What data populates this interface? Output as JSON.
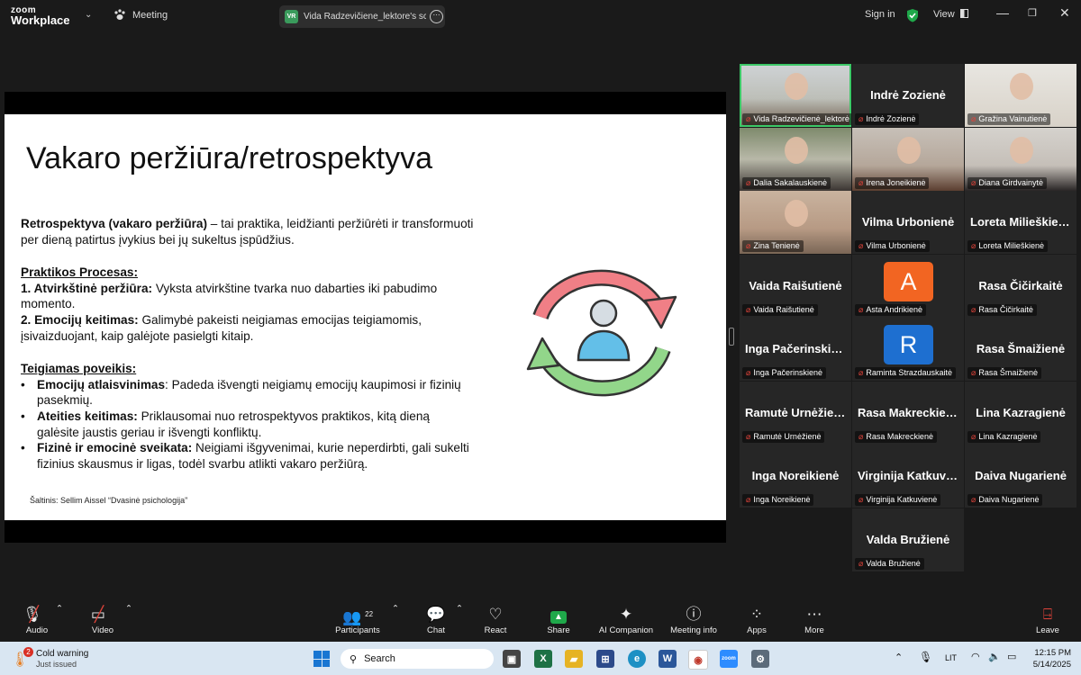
{
  "app": {
    "logo_line1": "zoom",
    "logo_line2": "Workplace",
    "meeting_label": "Meeting",
    "share_badge": "VR",
    "share_title": "Vida Radzevičiene_lektore's screen",
    "sign_in": "Sign in",
    "view_label": "View",
    "accent_green": "#3cc867"
  },
  "slide": {
    "title": "Vakaro peržiūra/retrospektyva",
    "intro_bold": "Retrospektyva (vakaro peržiūra)",
    "intro_rest": " – tai praktika, leidžianti peržiūrėti ir transformuoti per dieną patirtus įvykius bei jų sukeltus įspūdžius.",
    "process_heading": "Praktikos Procesas:",
    "step1_bold": "1. Atvirkštinė peržiūra:",
    "step1_rest": " Vyksta atvirkštine tvarka nuo dabarties iki pabudimo momento.",
    "step2_bold": "2. Emocijų keitimas:",
    "step2_rest": " Galimybė pakeisti neigiamas emocijas teigiamomis, įsivaizduojant, kaip galėjote pasielgti kitaip.",
    "effect_heading": "Teigiamas poveikis:",
    "bullet_char": "•",
    "bullets": [
      {
        "bold": "Emocijų atlaisvinimas",
        "rest": ": Padeda išvengti neigiamų emocijų kaupimosi ir fizinių pasekmių."
      },
      {
        "bold": "Ateities keitimas:",
        "rest": " Priklausomai nuo retrospektyvos praktikos, kitą dieną galėsite jaustis geriau ir išvengti konfliktų."
      },
      {
        "bold": "Fizinė ir emocinė sveikata:",
        "rest": " Neigiami išgyvenimai, kurie neperdirbti, gali sukelti fizinius skausmus ir ligas, todėl svarbu atlikti vakaro peržiūrą."
      }
    ],
    "source": "Šaltinis: Sellim Aissel “Dvasinė psichologija”"
  },
  "participants": [
    {
      "label": "Vida Radzevičienė_lektorė",
      "big": "",
      "type": "video"
    },
    {
      "label": "Indrė Zozienė",
      "big": "Indrė Zozienė",
      "type": "name"
    },
    {
      "label": "Gražina Vainutienė",
      "big": "",
      "type": "video"
    },
    {
      "label": "Dalia Sakalauskienė",
      "big": "",
      "type": "video"
    },
    {
      "label": "Irena Joneikienė",
      "big": "",
      "type": "video"
    },
    {
      "label": "Diana Girdvainytė",
      "big": "",
      "type": "video"
    },
    {
      "label": "Zina Tenienė",
      "big": "",
      "type": "video"
    },
    {
      "label": "Vilma Urbonienė",
      "big": "Vilma Urbonienė",
      "type": "name"
    },
    {
      "label": "Loreta Milieškienė",
      "big": "Loreta Milieškienė",
      "type": "name"
    },
    {
      "label": "Vaida Raišutienė",
      "big": "Vaida Raišutienė",
      "type": "name"
    },
    {
      "label": "Asta Andrikienė",
      "big": "A",
      "type": "avatar",
      "color": "#f26522"
    },
    {
      "label": "Rasa Čičirkaitė",
      "big": "Rasa Čičirkaitė",
      "type": "name"
    },
    {
      "label": "Inga Pačerinskienė",
      "big": "Inga Pačerinskienė",
      "type": "name"
    },
    {
      "label": "Raminta Strazdauskaitė",
      "big": "R",
      "type": "avatar",
      "color": "#1e6fd0"
    },
    {
      "label": "Rasa Šmaižienė",
      "big": "Rasa Šmaižienė",
      "type": "name"
    },
    {
      "label": "Ramutė Urnėžienė",
      "big": "Ramutė Urnėžienė",
      "type": "name"
    },
    {
      "label": "Rasa Makreckienė",
      "big": "Rasa Makreckienė",
      "type": "name"
    },
    {
      "label": "Lina Kazragienė",
      "big": "Lina Kazragienė",
      "type": "name"
    },
    {
      "label": "Inga Noreikienė",
      "big": "Inga Noreikienė",
      "type": "name"
    },
    {
      "label": "Virginija Katkuvienė",
      "big": "Virginija Katkuvienė",
      "type": "name"
    },
    {
      "label": "Daiva Nugarienė",
      "big": "Daiva Nugarienė",
      "type": "name"
    },
    {
      "label": "Valda Bružienė",
      "big": "Valda Bružienė",
      "type": "name"
    }
  ],
  "controls": {
    "audio": "Audio",
    "video": "Video",
    "participants": "Participants",
    "participants_count": "22",
    "chat": "Chat",
    "react": "React",
    "share": "Share",
    "ai_companion": "AI Companion",
    "meeting_info": "Meeting info",
    "apps": "Apps",
    "more": "More",
    "leave": "Leave"
  },
  "taskbar": {
    "weather_title": "Cold warning",
    "weather_sub": "Just issued",
    "weather_badge": "2",
    "search_placeholder": "Search",
    "lang": "LIT",
    "time": "12:15 PM",
    "date": "5/14/2025"
  }
}
